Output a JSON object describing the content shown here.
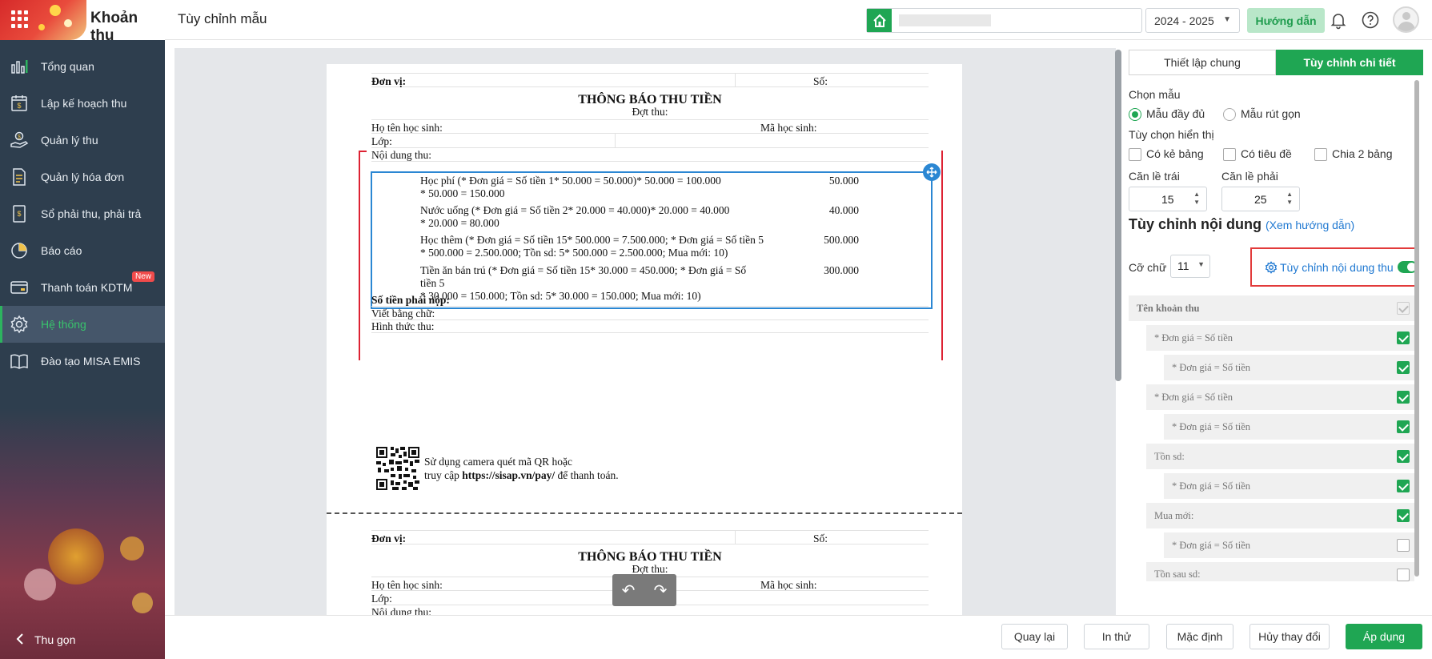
{
  "header": {
    "app_title": "Khoản thu",
    "page_title": "Tùy chỉnh mẫu",
    "school_year": "2024 - 2025",
    "help_label": "Hướng dẫn"
  },
  "sidebar": {
    "items": [
      {
        "label": "Tổng quan",
        "icon": "chart-bars-icon"
      },
      {
        "label": "Lập kế hoạch thu",
        "icon": "calendar-money-icon"
      },
      {
        "label": "Quản lý thu",
        "icon": "hand-money-icon"
      },
      {
        "label": "Quản lý hóa đơn",
        "icon": "invoice-icon"
      },
      {
        "label": "Sổ phải thu, phải trả",
        "icon": "ledger-icon"
      },
      {
        "label": "Báo cáo",
        "icon": "pie-chart-icon"
      },
      {
        "label": "Thanh toán KDTM",
        "icon": "card-icon",
        "badge": "New"
      },
      {
        "label": "Hệ thống",
        "icon": "gear-icon",
        "active": true
      },
      {
        "label": "Đào tạo MISA EMIS",
        "icon": "book-icon"
      }
    ],
    "collapse_label": "Thu gọn"
  },
  "document": {
    "unit_label": "Đơn vị:",
    "number_label": "Số:",
    "title": "THÔNG BÁO THU TIỀN",
    "period_label": "Đợt thu:",
    "student_name_label": "Họ tên học sinh:",
    "student_code_label": "Mã học sinh:",
    "class_label": "Lớp:",
    "content_label": "Nội dung thu:",
    "fee_items": [
      {
        "line1": "Học phí (* Đơn giá = Số tiền 1* 50.000 = 50.000)* 50.000 = 100.000",
        "line2": "* 50.000 = 150.000",
        "amount": "50.000"
      },
      {
        "line1": "Nước uống (* Đơn giá = Số tiền 2* 20.000 = 40.000)* 20.000 = 40.000",
        "line2": "* 20.000 = 80.000",
        "amount": "40.000"
      },
      {
        "line1": "Học thêm (* Đơn giá = Số tiền 15* 500.000 = 7.500.000; * Đơn giá = Số tiền 5",
        "line2": "* 500.000 = 2.500.000; Tồn sd: 5* 500.000 = 2.500.000; Mua mới: 10)",
        "amount": "500.000"
      },
      {
        "line1": "Tiền ăn bán trú (* Đơn giá = Số tiền 15* 30.000 = 450.000; * Đơn giá = Số tiền 5",
        "line2": "* 30.000 = 150.000; Tồn sd: 5* 30.000 = 150.000; Mua mới: 10)",
        "amount": "300.000"
      }
    ],
    "total_label": "Số tiền phải nộp:",
    "in_words_label": "Viết bằng chữ:",
    "method_label": "Hình thức thu:",
    "qr_line1": "Sử dụng camera quét mã QR hoặc",
    "qr_line2_prefix": "truy cập ",
    "qr_url": "https://sisap.vn/pay/",
    "qr_line2_suffix": " để thanh toán."
  },
  "panel": {
    "tab_general": "Thiết lập chung",
    "tab_detail": "Tùy chỉnh chi tiết",
    "choose_template_label": "Chọn mẫu",
    "template_full": "Mẫu đầy đủ",
    "template_short": "Mẫu rút gọn",
    "display_options_label": "Tùy chọn hiển thị",
    "opt_table_border": "Có kẻ bảng",
    "opt_title": "Có tiêu đề",
    "opt_split": "Chia 2 bảng",
    "margin_left_label": "Căn lề trái",
    "margin_left_value": "15",
    "margin_right_label": "Căn lề phải",
    "margin_right_value": "25",
    "content_custom_title": "Tùy chỉnh nội dung",
    "guide_link": "(Xem hướng dẫn)",
    "font_size_label": "Cỡ chữ",
    "font_size_value": "11",
    "custom_content_toggle_label": "Tùy chỉnh nội dung thu",
    "tree": [
      {
        "label": "Tên khoản thu",
        "checked": true,
        "disabled": true,
        "level": 0
      },
      {
        "label": "* Đơn giá = Số tiền",
        "checked": true,
        "level": 1
      },
      {
        "label": "* Đơn giá = Số tiền",
        "checked": true,
        "level": 2
      },
      {
        "label": "* Đơn giá = Số tiền",
        "checked": true,
        "level": 1
      },
      {
        "label": "* Đơn giá = Số tiền",
        "checked": true,
        "level": 2
      },
      {
        "label": "Tồn sd:",
        "checked": true,
        "level": 1
      },
      {
        "label": "* Đơn giá = Số tiền",
        "checked": true,
        "level": 2
      },
      {
        "label": "Mua mới:",
        "checked": true,
        "level": 1
      },
      {
        "label": "* Đơn giá = Số tiền",
        "checked": false,
        "level": 2
      },
      {
        "label": "Tồn sau sd:",
        "checked": false,
        "level": 1
      }
    ]
  },
  "footer": {
    "back": "Quay lại",
    "print_test": "In thử",
    "default": "Mặc định",
    "cancel_changes": "Hủy thay đổi",
    "apply": "Áp dụng"
  },
  "colors": {
    "accent_green": "#1fa653",
    "sidebar_bg": "#2e3e4e",
    "highlight_red": "#e23b3b",
    "selection_blue": "#2b87d3"
  }
}
